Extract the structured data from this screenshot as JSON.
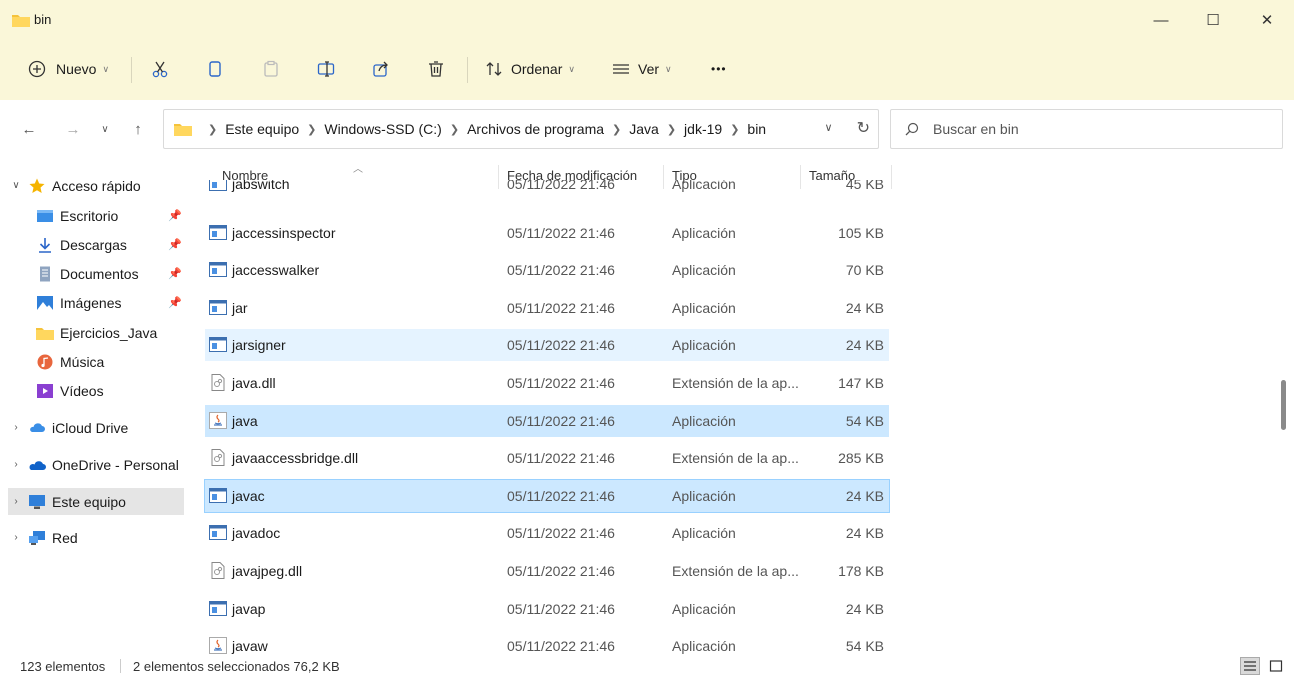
{
  "window": {
    "title": "bin"
  },
  "window_controls": {
    "minimize": "—",
    "maximize": "☐",
    "close": "✕"
  },
  "toolbar": {
    "new_label": "Nuevo",
    "sort_label": "Ordenar",
    "view_label": "Ver",
    "more_label": "•••"
  },
  "address": {
    "crumbs": [
      "Este equipo",
      "Windows-SSD (C:)",
      "Archivos de programa",
      "Java",
      "jdk-19",
      "bin"
    ]
  },
  "search": {
    "placeholder": "Buscar en bin"
  },
  "sidebar": {
    "items": [
      {
        "label": "Acceso rápido"
      },
      {
        "label": "Escritorio"
      },
      {
        "label": "Descargas"
      },
      {
        "label": "Documentos"
      },
      {
        "label": "Imágenes"
      },
      {
        "label": "Ejercicios_Java"
      },
      {
        "label": "Música"
      },
      {
        "label": "Vídeos"
      },
      {
        "label": "iCloud Drive"
      },
      {
        "label": "OneDrive - Personal"
      },
      {
        "label": "Este equipo"
      },
      {
        "label": "Red"
      }
    ]
  },
  "columns": {
    "name": "Nombre",
    "date": "Fecha de modificación",
    "type": "Tipo",
    "size": "Tamaño"
  },
  "files": [
    {
      "name": "jabswitch",
      "date": "05/11/2022 21:46",
      "type": "Aplicación",
      "size": "45 KB"
    },
    {
      "name": "jaccessinspector",
      "date": "05/11/2022 21:46",
      "type": "Aplicación",
      "size": "105 KB"
    },
    {
      "name": "jaccesswalker",
      "date": "05/11/2022 21:46",
      "type": "Aplicación",
      "size": "70 KB"
    },
    {
      "name": "jar",
      "date": "05/11/2022 21:46",
      "type": "Aplicación",
      "size": "24 KB"
    },
    {
      "name": "jarsigner",
      "date": "05/11/2022 21:46",
      "type": "Aplicación",
      "size": "24 KB"
    },
    {
      "name": "java.dll",
      "date": "05/11/2022 21:46",
      "type": "Extensión de la ap...",
      "size": "147 KB"
    },
    {
      "name": "java",
      "date": "05/11/2022 21:46",
      "type": "Aplicación",
      "size": "54 KB"
    },
    {
      "name": "javaaccessbridge.dll",
      "date": "05/11/2022 21:46",
      "type": "Extensión de la ap...",
      "size": "285 KB"
    },
    {
      "name": "javac",
      "date": "05/11/2022 21:46",
      "type": "Aplicación",
      "size": "24 KB"
    },
    {
      "name": "javadoc",
      "date": "05/11/2022 21:46",
      "type": "Aplicación",
      "size": "24 KB"
    },
    {
      "name": "javajpeg.dll",
      "date": "05/11/2022 21:46",
      "type": "Extensión de la ap...",
      "size": "178 KB"
    },
    {
      "name": "javap",
      "date": "05/11/2022 21:46",
      "type": "Aplicación",
      "size": "24 KB"
    },
    {
      "name": "javaw",
      "date": "05/11/2022 21:46",
      "type": "Aplicación",
      "size": "54 KB"
    }
  ],
  "status": {
    "count": "123 elementos",
    "selection": "2 elementos seleccionados  76,2 KB"
  },
  "colors": {
    "accent": "#0067c0",
    "selected_row": "#cce8ff",
    "hover_row": "#e5f3ff",
    "titlebar": "#faf7d9",
    "folder": "#f5c33b"
  }
}
